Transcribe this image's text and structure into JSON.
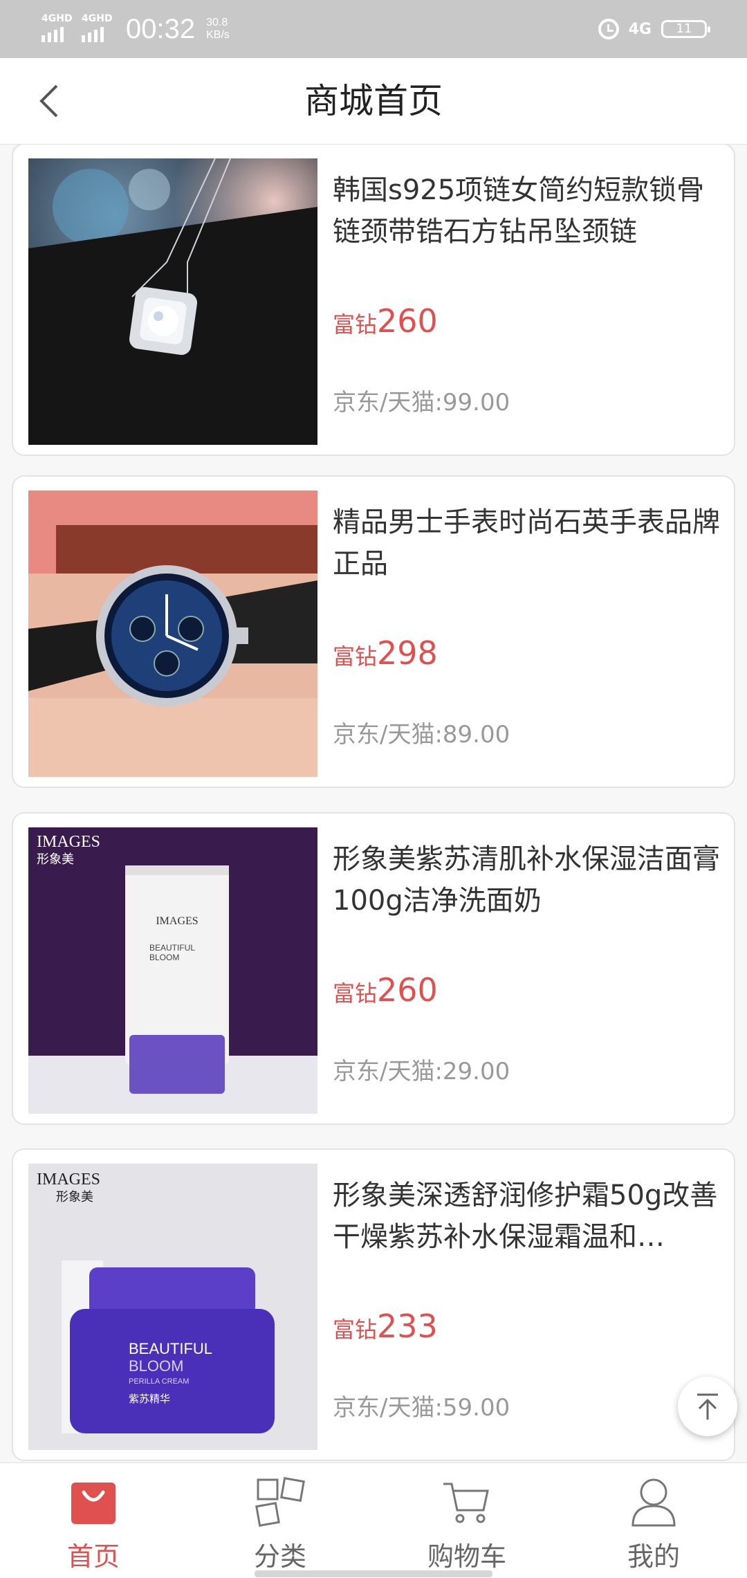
{
  "status_bar": {
    "signal_1": "4GHD",
    "signal_2": "4GHD",
    "time": "00:32",
    "speed_value": "30.8",
    "speed_unit": "KB/s",
    "network": "4G",
    "battery": "11",
    "icons": [
      "signal-icon",
      "alarm-icon",
      "battery-icon"
    ]
  },
  "header": {
    "title": "商城首页",
    "back_icon": "chevron-left-icon"
  },
  "products": [
    {
      "name": "韩国s925项链女简约短款锁骨链颈带锆石方钻吊坠颈链",
      "price_prefix": "富钻",
      "price": "260",
      "ref_price": "京东/天猫:99.00",
      "image": "necklace"
    },
    {
      "name": "精品男士手表时尚石英手表品牌正品",
      "price_prefix": "富钻",
      "price": "298",
      "ref_price": "京东/天猫:89.00",
      "image": "watch"
    },
    {
      "name": "形象美紫苏清肌补水保湿洁面膏100g洁净洗面奶",
      "price_prefix": "富钻",
      "price": "260",
      "ref_price": "京东/天猫:29.00",
      "image": "cleanser",
      "image_brand": "IMAGES",
      "image_brand_cn": "形象美",
      "image_text": [
        "IMAGES",
        "BEAUTIFUL",
        "BLOOM"
      ]
    },
    {
      "name": "形象美深透舒润修护霜50g改善干燥紫苏补水保湿霜温和…",
      "price_prefix": "富钻",
      "price": "233",
      "ref_price": "京东/天猫:59.00",
      "image": "cream",
      "image_brand": "IMAGES",
      "image_brand_cn": "形象美",
      "image_text": [
        "BEAUTIFUL",
        "BLOOM",
        "PERILLA CREAM",
        "紫苏精华"
      ]
    }
  ],
  "back_to_top_icon": "arrow-up-to-top-icon",
  "tabbar": {
    "tabs": [
      {
        "label": "首页",
        "icon": "shopping-bag-icon",
        "active": true
      },
      {
        "label": "分类",
        "icon": "category-icon",
        "active": false
      },
      {
        "label": "购物车",
        "icon": "cart-icon",
        "active": false
      },
      {
        "label": "我的",
        "icon": "user-icon",
        "active": false
      }
    ]
  },
  "colors": {
    "accent": "#e0504f",
    "muted": "#999999",
    "statusbar": "#c8c8c8"
  }
}
